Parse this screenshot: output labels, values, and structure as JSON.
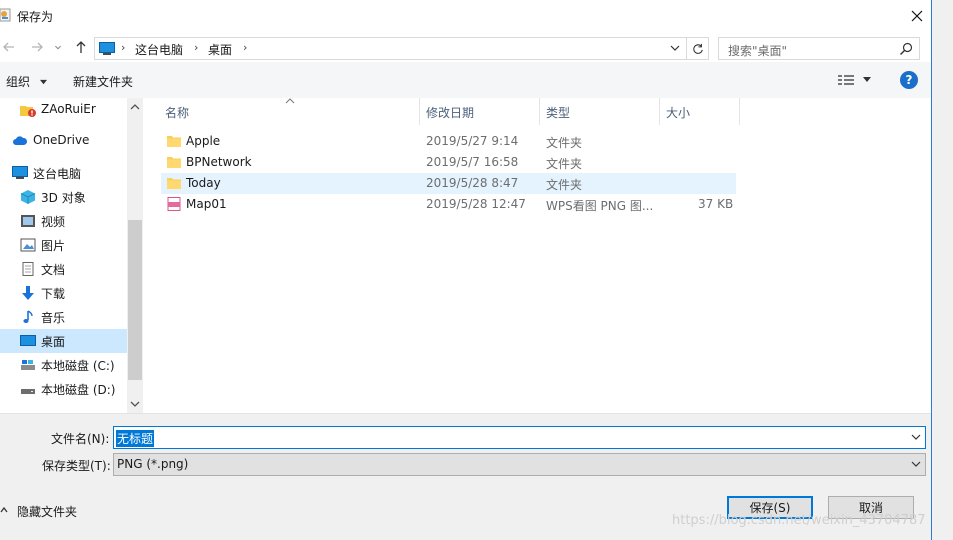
{
  "window": {
    "title": "保存为"
  },
  "nav": {
    "breadcrumb": [
      "这台电脑",
      "桌面"
    ],
    "search_placeholder": "搜索\"桌面\""
  },
  "toolbar": {
    "organize_label": "组织",
    "new_folder_label": "新建文件夹",
    "help_label": "?"
  },
  "sidebar": {
    "items": [
      {
        "label": "ZAoRuiEr",
        "icon": "user-folder-icon"
      },
      {
        "label": "OneDrive",
        "icon": "cloud-icon"
      },
      {
        "label": "这台电脑",
        "icon": "computer-icon"
      },
      {
        "label": "3D 对象",
        "icon": "cube-icon"
      },
      {
        "label": "视频",
        "icon": "video-icon"
      },
      {
        "label": "图片",
        "icon": "picture-icon"
      },
      {
        "label": "文档",
        "icon": "document-icon"
      },
      {
        "label": "下载",
        "icon": "download-icon"
      },
      {
        "label": "音乐",
        "icon": "music-icon"
      },
      {
        "label": "桌面",
        "icon": "desktop-icon",
        "selected": true
      },
      {
        "label": "本地磁盘 (C:)",
        "icon": "drive-icon"
      },
      {
        "label": "本地磁盘 (D:)",
        "icon": "drive-icon"
      }
    ]
  },
  "columns": {
    "name": "名称",
    "modified": "修改日期",
    "type": "类型",
    "size": "大小"
  },
  "files": [
    {
      "name": "Apple",
      "modified": "2019/5/27 9:14",
      "type": "文件夹",
      "size": "",
      "icon": "folder-icon"
    },
    {
      "name": "BPNetwork",
      "modified": "2019/5/7 16:58",
      "type": "文件夹",
      "size": "",
      "icon": "folder-icon"
    },
    {
      "name": "Today",
      "modified": "2019/5/28 8:47",
      "type": "文件夹",
      "size": "",
      "icon": "folder-icon",
      "selected": true
    },
    {
      "name": "Map01",
      "modified": "2019/5/28 12:47",
      "type": "WPS看图 PNG 图...",
      "size": "37 KB",
      "icon": "png-file-icon"
    }
  ],
  "form": {
    "filename_label": "文件名(N):",
    "filename_value": "无标题",
    "filetype_label": "保存类型(T):",
    "filetype_value": "PNG (*.png)",
    "hide_folders_label": "隐藏文件夹",
    "save_label": "保存(S)",
    "cancel_label": "取消"
  },
  "watermark": "https://blog.csdn.net/weixin_43704787",
  "colors": {
    "accent": "#0078d7",
    "selection": "#cce8ff",
    "help": "#1a6fc9"
  }
}
